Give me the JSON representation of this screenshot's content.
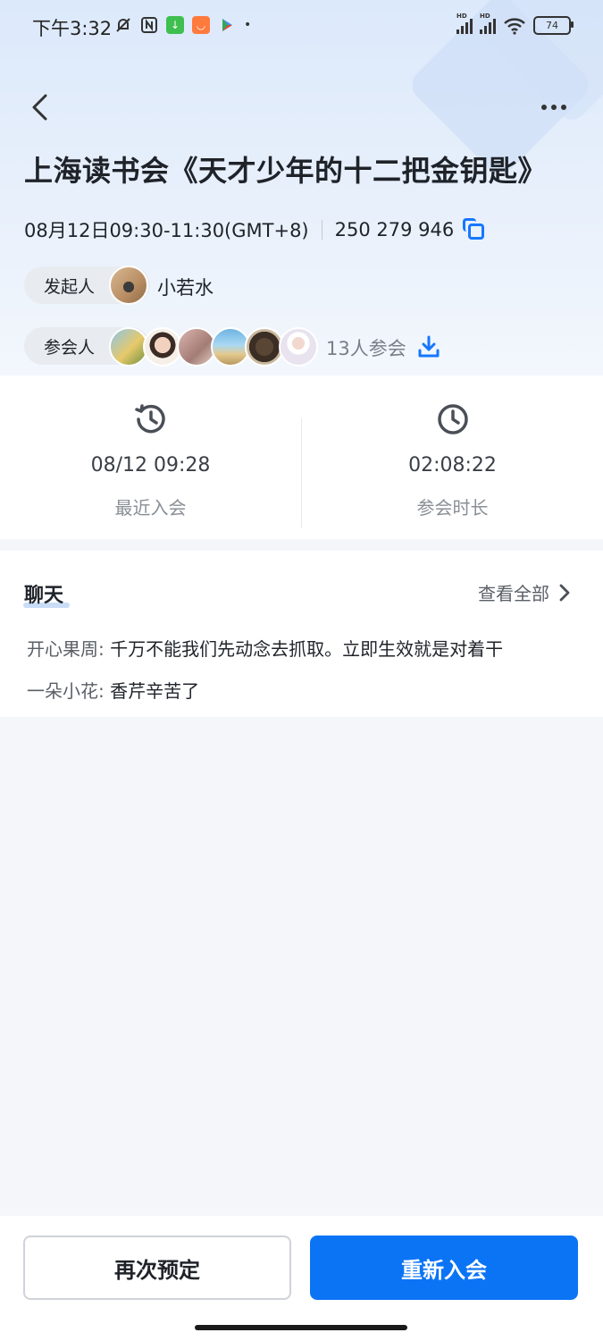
{
  "status_bar": {
    "time": "下午3:32",
    "battery": "74",
    "hd_label": "HD"
  },
  "nav": {
    "back_icon": "chevron-left-icon",
    "more_icon": "more-dots-icon"
  },
  "meeting": {
    "title": "上海读书会《天才少年的十二把金钥匙》",
    "time_range": "08月12日09:30-11:30(GMT+8)",
    "meeting_id": "250 279 946",
    "host_label": "发起人",
    "host_name": "小若水",
    "attendees_label": "参会人",
    "attendee_count": "13人参会"
  },
  "stats": {
    "last_join_value": "08/12 09:28",
    "last_join_label": "最近入会",
    "duration_value": "02:08:22",
    "duration_label": "参会时长"
  },
  "chat": {
    "title": "聊天",
    "view_all": "查看全部",
    "messages": [
      {
        "sender": "开心果周: ",
        "text": "千万不能我们先动念去抓取。立即生效就是对着干"
      },
      {
        "sender": "一朵小花: ",
        "text": "香芹辛苦了"
      }
    ]
  },
  "actions": {
    "rebook": "再次预定",
    "rejoin": "重新入会"
  },
  "colors": {
    "accent": "#0b74f5",
    "header_gradient_top": "#dce9fb"
  }
}
